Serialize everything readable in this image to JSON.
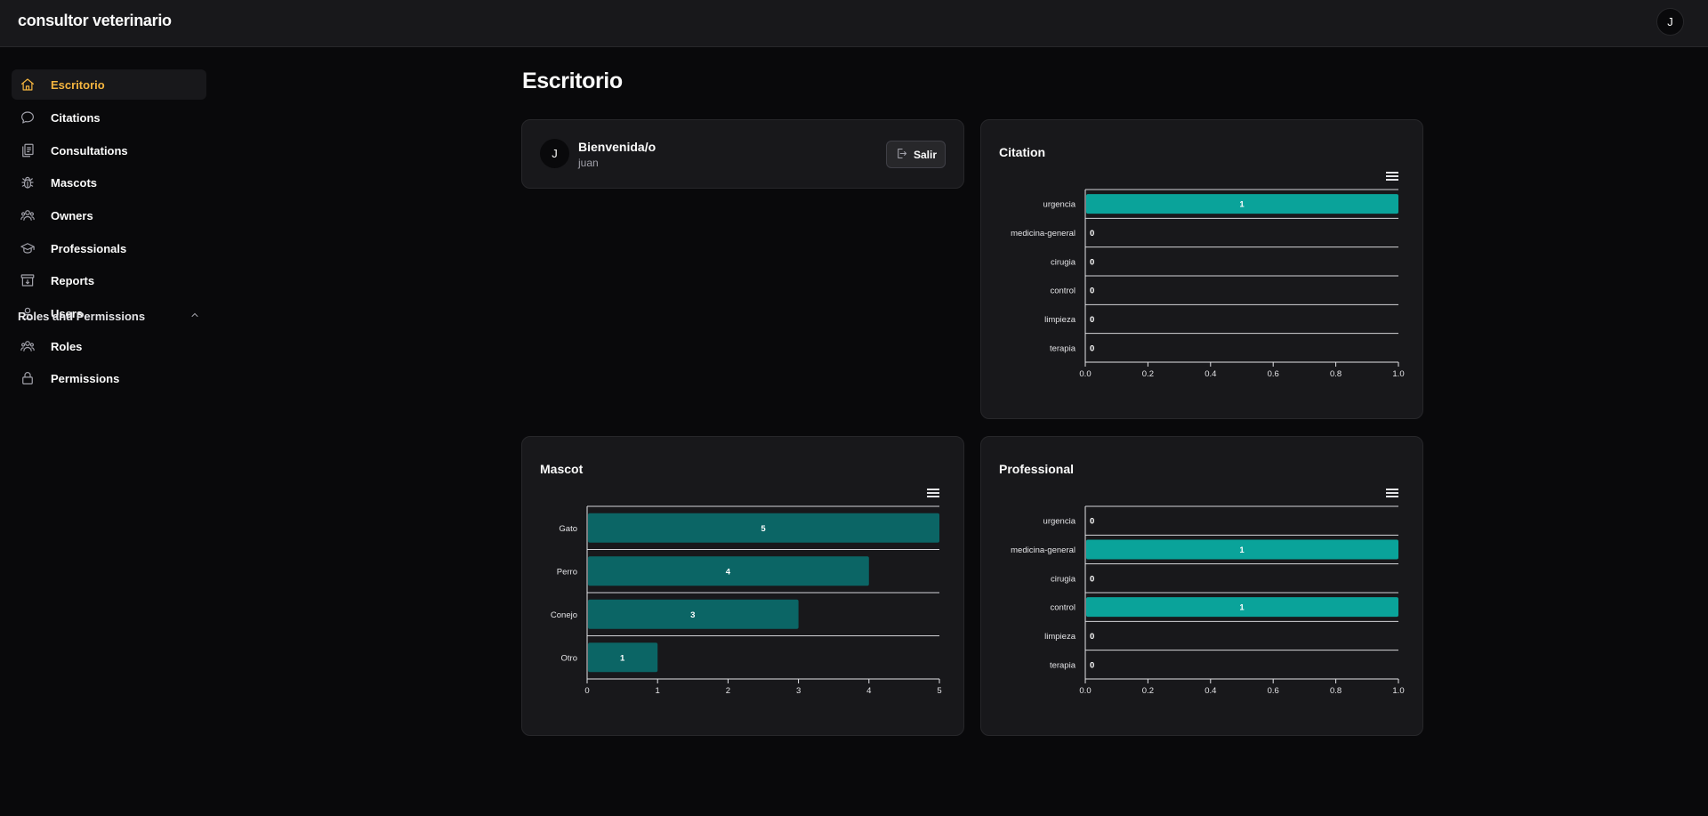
{
  "app": {
    "title": "consultor veterinario",
    "user_initial": "J"
  },
  "sidebar": {
    "items": [
      {
        "label": "Escritorio",
        "icon": "home-icon"
      },
      {
        "label": "Citations",
        "icon": "chat-bubble-icon"
      },
      {
        "label": "Consultations",
        "icon": "document-stack-icon"
      },
      {
        "label": "Mascots",
        "icon": "bug-icon"
      },
      {
        "label": "Owners",
        "icon": "users-icon"
      },
      {
        "label": "Professionals",
        "icon": "graduation-cap-icon"
      },
      {
        "label": "Reports",
        "icon": "archive-box-icon"
      },
      {
        "label": "Users",
        "icon": "user-icon"
      }
    ],
    "group": {
      "title": "Roles and Permissions",
      "items": [
        {
          "label": "Roles",
          "icon": "user-group-icon"
        },
        {
          "label": "Permissions",
          "icon": "lock-icon"
        }
      ]
    },
    "active_color": "#f5b53f"
  },
  "page": {
    "title": "Escritorio"
  },
  "welcome": {
    "initial": "J",
    "title": "Bienvenida/o",
    "user": "juan",
    "logout_label": "Salir"
  },
  "colors": {
    "bar_teal": "#0aa39a",
    "bar_dark_teal": "#0b6565",
    "card_bg": "#18181b"
  },
  "chart_data": [
    {
      "title": "Citation",
      "type": "bar",
      "orientation": "horizontal",
      "categories": [
        "urgencia",
        "medicina-general",
        "cirugia",
        "control",
        "limpieza",
        "terapia"
      ],
      "values": [
        1,
        0,
        0,
        0,
        0,
        0
      ],
      "xlim": [
        0,
        1
      ],
      "ticks": [
        "0.0",
        "0.2",
        "0.4",
        "0.6",
        "0.8",
        "1.0"
      ],
      "color": "#0aa39a"
    },
    {
      "title": "Mascot",
      "type": "bar",
      "orientation": "horizontal",
      "categories": [
        "Gato",
        "Perro",
        "Conejo",
        "Otro"
      ],
      "values": [
        5,
        4,
        3,
        1
      ],
      "xlim": [
        0,
        5
      ],
      "ticks": [
        "0",
        "1",
        "2",
        "3",
        "4",
        "5"
      ],
      "color": "#0b6565"
    },
    {
      "title": "Professional",
      "type": "bar",
      "orientation": "horizontal",
      "categories": [
        "urgencia",
        "medicina-general",
        "cirugia",
        "control",
        "limpieza",
        "terapia"
      ],
      "values": [
        0,
        1,
        0,
        1,
        0,
        0
      ],
      "xlim": [
        0,
        1
      ],
      "ticks": [
        "0.0",
        "0.2",
        "0.4",
        "0.6",
        "0.8",
        "1.0"
      ],
      "color": "#0aa39a"
    }
  ]
}
